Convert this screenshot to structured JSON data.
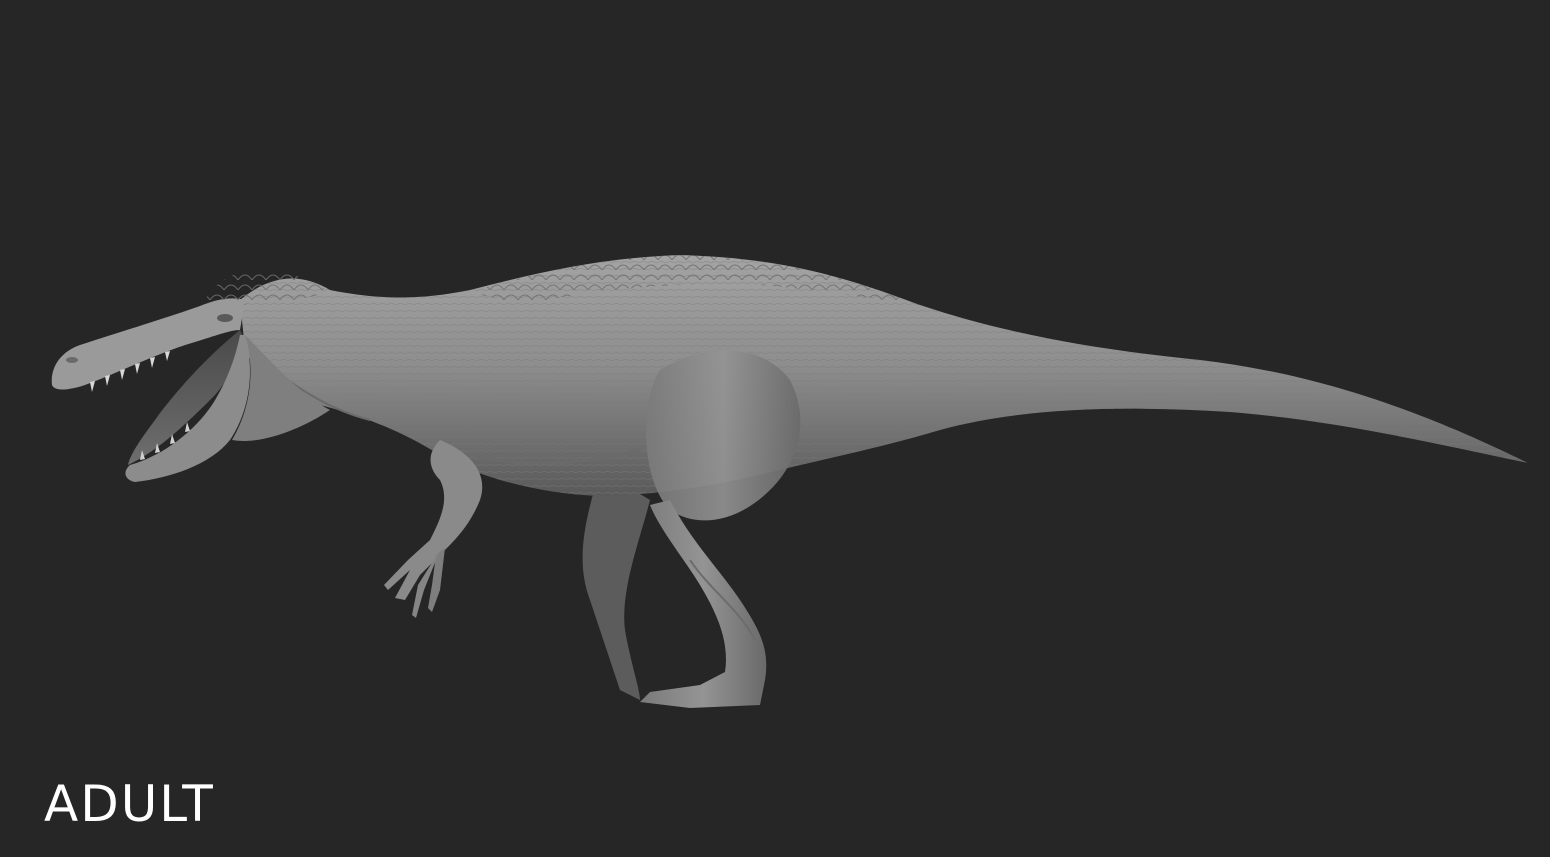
{
  "scene": {
    "background_color": "#262626",
    "model_color": "#8f8f8f",
    "subject_icon": "dinosaur-sculpt",
    "caption": "ADULT",
    "caption_color": "#ffffff"
  }
}
